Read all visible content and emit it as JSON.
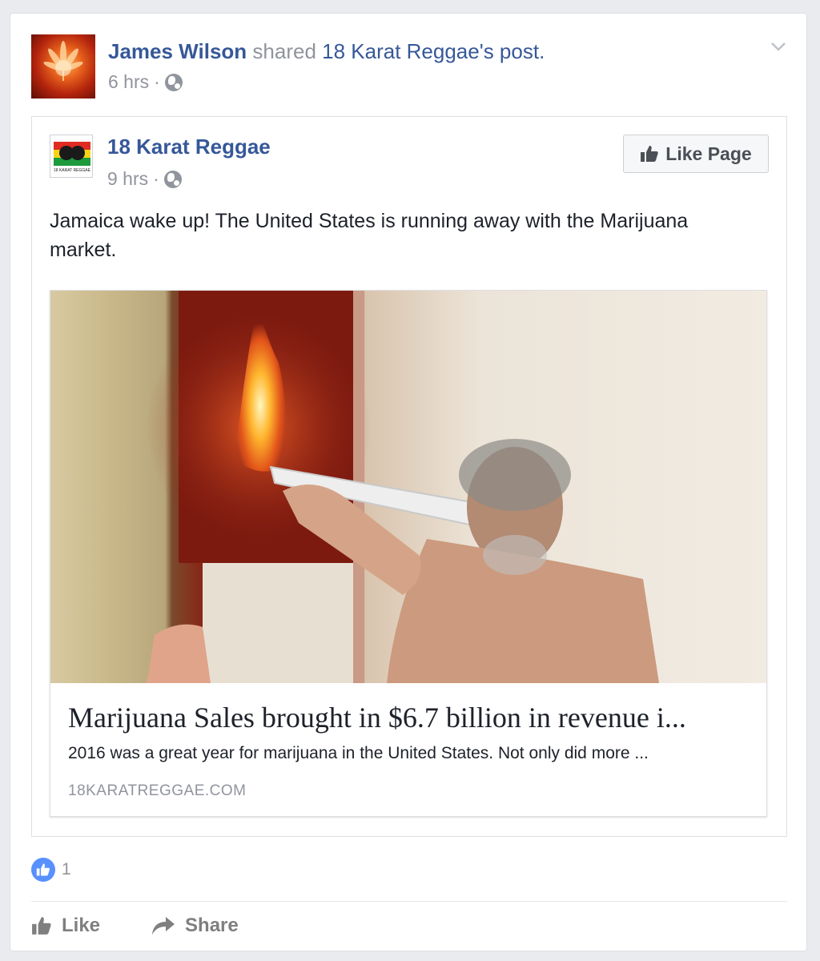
{
  "post": {
    "author": "James Wilson",
    "shared_text": "shared",
    "shared_page": "18 Karat Reggae",
    "post_suffix": "'s post.",
    "time": "6 hrs",
    "separator": "·"
  },
  "shared_post": {
    "page_name": "18 Karat Reggae",
    "time": "9 hrs",
    "separator": "·",
    "like_page_label": "Like Page",
    "logo_caption": "18 KARAT REGGAE",
    "text": "Jamaica wake up! The United States is running away with the Marijuana market."
  },
  "link_card": {
    "title": "Marijuana Sales brought in $6.7 billion in revenue i...",
    "description": "2016 was a great year for marijuana in the United States. Not only did more ...",
    "domain": "18KARATREGGAE.COM"
  },
  "reactions": {
    "count": "1"
  },
  "actions": {
    "like_label": "Like",
    "share_label": "Share"
  },
  "colors": {
    "link_blue": "#365899",
    "muted_gray": "#90949c",
    "like_blue": "#5890ff"
  }
}
